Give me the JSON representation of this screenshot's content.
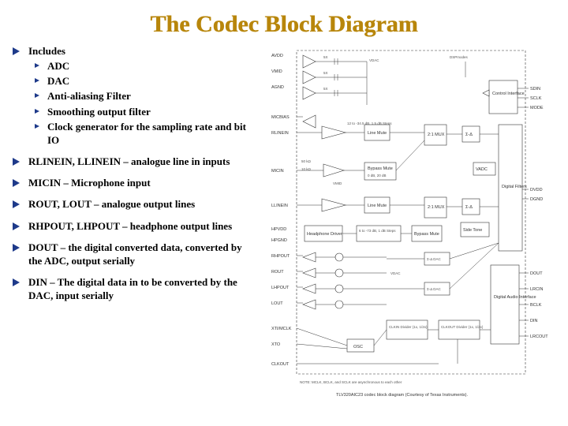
{
  "title": "The Codec Block Diagram",
  "bullets": {
    "includes_label": "Includes",
    "includes": [
      "ADC",
      "DAC",
      "Anti-aliasing Filter",
      "Smoothing output filter",
      "Clock generator for the sampling rate and bit IO"
    ],
    "linein": "RLINEIN, LLINEIN – analogue line in inputs",
    "micin": "MICIN – Microphone input",
    "out": "ROUT, LOUT – analogue output lines",
    "hpout": "RHPOUT, LHPOUT – headphone output lines",
    "dout": "DOUT – the digital converted data, converted by the ADC, output serially",
    "din": "DIN – The digital data in to be converted by the DAC, input serially"
  },
  "diagram": {
    "left_pins": [
      "AVDD",
      "VMID",
      "AGND",
      "MICBIAS",
      "RLINEIN",
      "MICIN",
      "LLINEIN",
      "HPVDD",
      "HPGND",
      "RHPOUT",
      "ROUT",
      "LHPOUT",
      "LOUT",
      "XTI/MCLK",
      "XTO",
      "CLKOUT"
    ],
    "right_pins": [
      "SDIN",
      "SCLK",
      "MODE",
      "DVDD",
      "DGND",
      "DOUT",
      "LRCIN",
      "BCLK",
      "DIN",
      "LRCOUT"
    ],
    "internal_blocks": {
      "top_caps": [
        "5X",
        "5X",
        "5X"
      ],
      "vdac_top": "VDAC",
      "dsp": "DSPmodes",
      "control_iface": "Control Interface",
      "line_mute_r": "Line Mute",
      "line_mute_l": "Line Mute",
      "mux_21": "2:1 MUX",
      "sigma_delta_l": "Σ-Δ",
      "sigma_delta_r": "Σ-Δ",
      "sigma_delta_dac_a": "Σ-Δ DAC",
      "sigma_delta_dac_b": "Σ-Δ DAC",
      "vadc": "VADC",
      "bypass_mute": "Bypass Mute",
      "mic_gain": "0 dB, 20 dB",
      "hp_driver": "Headphone Driver",
      "hp_atten": "6 to -73 dB, 1 dB Steps",
      "bypass_mute2": "Bypass Mute",
      "sidetone": "Side Tone",
      "line_atten": "12 to -34.5 dB, 1.5 dB Steps",
      "vdac_low": "VDAC",
      "digital_filters": "Digital Filters",
      "digital_audio_iface": "Digital Audio Interface",
      "clkin_div": "CLKIN Divider (1x, 1/2x)",
      "clkout_div": "CLKOUT Divider (1x, 1/2x)",
      "osc": "OSC",
      "res": "50 kΩ",
      "res2": "10 kΩ"
    },
    "note": "NOTE: MCLK, BCLK, and SCLK are asynchronous to each other",
    "caption": "TLV320AIC23 codec block diagram (Courtesy of Texas Instruments)."
  }
}
